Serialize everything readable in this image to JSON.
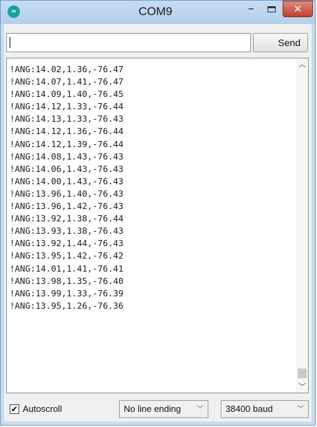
{
  "window": {
    "title": "COM9",
    "app_icon": "arduino-logo-icon",
    "minimize_glyph": "–",
    "close_glyph": "✕"
  },
  "input": {
    "value": ""
  },
  "send_label": "Send",
  "output": {
    "lines": [
      "!ANG:14.02,1.36,-76.47",
      "!ANG:14.07,1.41,-76.47",
      "!ANG:14.09,1.40,-76.45",
      "!ANG:14.12,1.33,-76.44",
      "!ANG:14.13,1.33,-76.43",
      "!ANG:14.12,1.36,-76.44",
      "!ANG:14.12,1.39,-76.44",
      "!ANG:14.08,1.43,-76.43",
      "!ANG:14.06,1.43,-76.43",
      "!ANG:14.00,1.43,-76.43",
      "!ANG:13.96,1.40,-76.43",
      "!ANG:13.96,1.42,-76.43",
      "!ANG:13.92,1.38,-76.44",
      "!ANG:13.93,1.38,-76.43",
      "!ANG:13.92,1.44,-76.43",
      "!ANG:13.95,1.42,-76.42",
      "!ANG:14.01,1.41,-76.41",
      "!ANG:13.98,1.35,-76.40",
      "!ANG:13.99,1.33,-76.39",
      "!ANG:13.95,1.26,-76.36"
    ]
  },
  "footer": {
    "autoscroll_label": "Autoscroll",
    "autoscroll_checked": true,
    "line_ending": "No line ending",
    "baud": "38400 baud"
  },
  "icons": {
    "scroll_up": "chevron-up-icon",
    "scroll_down": "chevron-down-icon",
    "dropdown": "chevron-down-icon"
  }
}
